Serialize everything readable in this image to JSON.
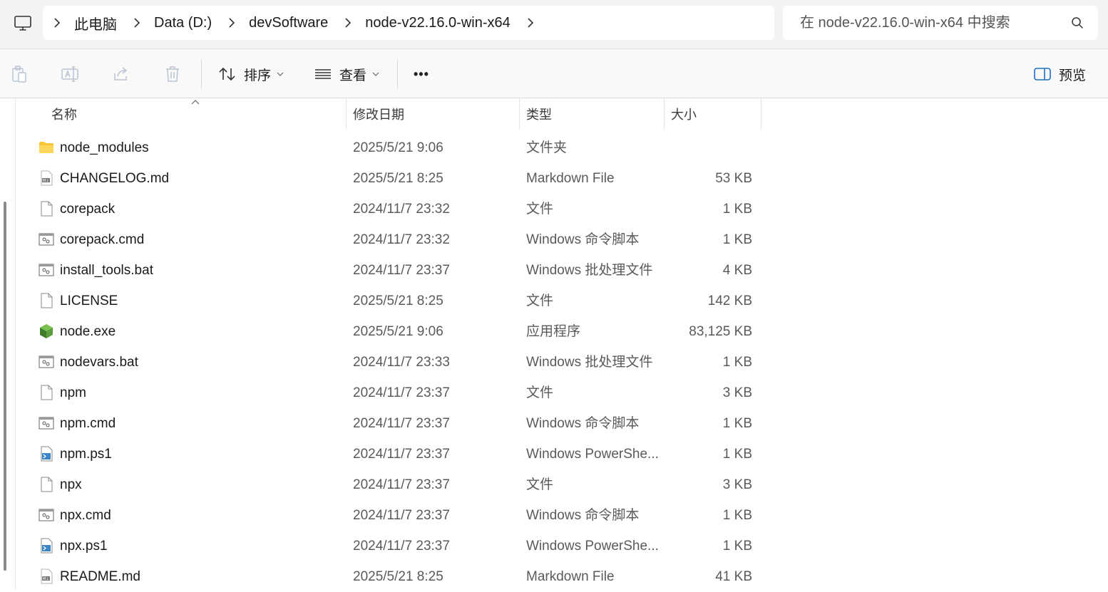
{
  "breadcrumb": [
    "此电脑",
    "Data (D:)",
    "devSoftware",
    "node-v22.16.0-win-x64"
  ],
  "search": {
    "placeholder": "在 node-v22.16.0-win-x64 中搜索"
  },
  "toolbar": {
    "sort_label": "排序",
    "view_label": "查看",
    "more_label": "•••",
    "preview_label": "预览"
  },
  "columns": {
    "name": "名称",
    "date": "修改日期",
    "type": "类型",
    "size": "大小"
  },
  "files": [
    {
      "name": "node_modules",
      "date": "2025/5/21 9:06",
      "type": "文件夹",
      "size": "",
      "icon": "folder-icon"
    },
    {
      "name": "CHANGELOG.md",
      "date": "2025/5/21 8:25",
      "type": "Markdown File",
      "size": "53 KB",
      "icon": "markdown-file-icon"
    },
    {
      "name": "corepack",
      "date": "2024/11/7 23:32",
      "type": "文件",
      "size": "1 KB",
      "icon": "file-icon"
    },
    {
      "name": "corepack.cmd",
      "date": "2024/11/7 23:32",
      "type": "Windows 命令脚本",
      "size": "1 KB",
      "icon": "script-file-icon"
    },
    {
      "name": "install_tools.bat",
      "date": "2024/11/7 23:37",
      "type": "Windows 批处理文件",
      "size": "4 KB",
      "icon": "script-file-icon"
    },
    {
      "name": "LICENSE",
      "date": "2025/5/21 8:25",
      "type": "文件",
      "size": "142 KB",
      "icon": "file-icon"
    },
    {
      "name": "node.exe",
      "date": "2025/5/21 9:06",
      "type": "应用程序",
      "size": "83,125 KB",
      "icon": "node-exe-icon"
    },
    {
      "name": "nodevars.bat",
      "date": "2024/11/7 23:33",
      "type": "Windows 批处理文件",
      "size": "1 KB",
      "icon": "script-file-icon"
    },
    {
      "name": "npm",
      "date": "2024/11/7 23:37",
      "type": "文件",
      "size": "3 KB",
      "icon": "file-icon"
    },
    {
      "name": "npm.cmd",
      "date": "2024/11/7 23:37",
      "type": "Windows 命令脚本",
      "size": "1 KB",
      "icon": "script-file-icon"
    },
    {
      "name": "npm.ps1",
      "date": "2024/11/7 23:37",
      "type": "Windows PowerShe...",
      "size": "1 KB",
      "icon": "powershell-file-icon"
    },
    {
      "name": "npx",
      "date": "2024/11/7 23:37",
      "type": "文件",
      "size": "3 KB",
      "icon": "file-icon"
    },
    {
      "name": "npx.cmd",
      "date": "2024/11/7 23:37",
      "type": "Windows 命令脚本",
      "size": "1 KB",
      "icon": "script-file-icon"
    },
    {
      "name": "npx.ps1",
      "date": "2024/11/7 23:37",
      "type": "Windows PowerShe...",
      "size": "1 KB",
      "icon": "powershell-file-icon"
    },
    {
      "name": "README.md",
      "date": "2025/5/21 8:25",
      "type": "Markdown File",
      "size": "41 KB",
      "icon": "markdown-file-icon"
    }
  ],
  "colors": {
    "folder": "#f8c537",
    "node_green": "#5a9e3c",
    "accent": "#1f6fc5"
  }
}
